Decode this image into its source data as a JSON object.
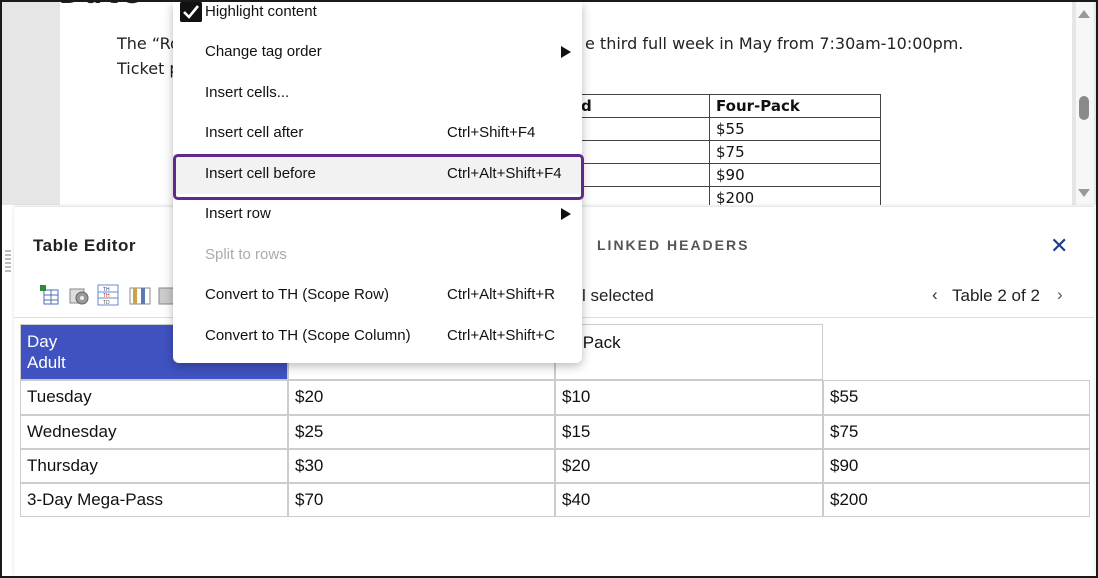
{
  "document": {
    "heading_fragment": "Date",
    "line1_left": "The “Ro",
    "line1_right": "e third full week in May from 7:30am-10:00pm.",
    "line2_left": "Ticket p",
    "table_headers": [
      "d",
      "Four-Pack"
    ],
    "table_rows": [
      [
        "",
        "$55"
      ],
      [
        "",
        "$75"
      ],
      [
        "",
        "$90"
      ],
      [
        "",
        "$200"
      ]
    ]
  },
  "context_menu": {
    "items": [
      {
        "label": "Highlight content",
        "checked": true,
        "shortcut": "",
        "submenu": false,
        "disabled": false
      },
      {
        "label": "Change tag order",
        "shortcut": "",
        "submenu": true,
        "disabled": false
      },
      {
        "label": "Insert cells...",
        "shortcut": "",
        "submenu": false,
        "disabled": false
      },
      {
        "label": "Insert cell after",
        "shortcut": "Ctrl+Shift+F4",
        "submenu": false,
        "disabled": false
      },
      {
        "label": "Insert cell before",
        "shortcut": "Ctrl+Alt+Shift+F4",
        "submenu": false,
        "disabled": false,
        "highlighted": true
      },
      {
        "label": "Insert row",
        "shortcut": "",
        "submenu": true,
        "disabled": false
      },
      {
        "label": "Split to rows",
        "shortcut": "",
        "submenu": false,
        "disabled": true
      },
      {
        "label": "Convert to TH (Scope Row)",
        "shortcut": "Ctrl+Alt+Shift+R",
        "submenu": false,
        "disabled": false
      },
      {
        "label": "Convert to TH (Scope Column)",
        "shortcut": "Ctrl+Alt+Shift+C",
        "submenu": false,
        "disabled": false
      }
    ]
  },
  "table_editor": {
    "title": "Table Editor",
    "linked_headers_tab": "LINKED HEADERS",
    "selection_text": "l selected",
    "table_nav": "Table 2 of 2",
    "header_row": [
      "Day\nAdult",
      "",
      "ur-Pack",
      ""
    ],
    "rows": [
      [
        "Tuesday",
        "$20",
        "$10",
        "$55"
      ],
      [
        "Wednesday",
        "$25",
        "$15",
        "$75"
      ],
      [
        "Thursday",
        "$30",
        "$20",
        "$90"
      ],
      [
        "3-Day  Mega-Pass",
        "$70",
        "$40",
        "$200"
      ]
    ]
  },
  "colors": {
    "selected_header": "#3f52c0",
    "highlight_ring": "#5e2a8c",
    "close_icon": "#1f3b8a"
  }
}
